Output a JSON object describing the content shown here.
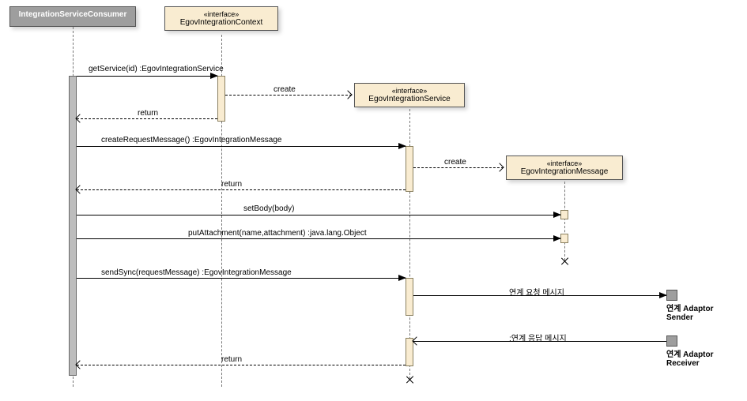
{
  "participants": {
    "consumer": {
      "name": "IntegrationServiceConsumer"
    },
    "context": {
      "stereotype": "«interface»",
      "name": "EgovIntegrationContext"
    },
    "service": {
      "stereotype": "«interface»",
      "name": "EgovIntegrationService"
    },
    "message": {
      "stereotype": "«interface»",
      "name": "EgovIntegrationMessage"
    }
  },
  "messages": {
    "getService": "getService(id) :EgovIntegrationService",
    "create1": "create",
    "return1": "return",
    "createRequest": "createRequestMessage() :EgovIntegrationMessage",
    "create2": "create",
    "return2": "return",
    "setBody": "setBody(body)",
    "putAttachment": "putAttachment(name,attachment) :java.lang.Object",
    "sendSync": "sendSync(requestMessage) :EgovIntegrationMessage",
    "requestMsg": "연계 요청 메시지",
    "replyMsg": ":연계 응답 메시지",
    "return3": "return"
  },
  "actors": {
    "sender": "연계 Adaptor Sender",
    "receiver": "연계 Adaptor Receiver"
  },
  "chart_data": {
    "type": "sequence-diagram",
    "participants": [
      "IntegrationServiceConsumer",
      "EgovIntegrationContext",
      "EgovIntegrationService",
      "EgovIntegrationMessage",
      "연계 Adaptor Sender",
      "연계 Adaptor Receiver"
    ],
    "interactions": [
      {
        "from": "IntegrationServiceConsumer",
        "to": "EgovIntegrationContext",
        "label": "getService(id) :EgovIntegrationService",
        "style": "call"
      },
      {
        "from": "EgovIntegrationContext",
        "to": "EgovIntegrationService",
        "label": "create",
        "style": "create"
      },
      {
        "from": "EgovIntegrationContext",
        "to": "IntegrationServiceConsumer",
        "label": "return",
        "style": "return"
      },
      {
        "from": "IntegrationServiceConsumer",
        "to": "EgovIntegrationService",
        "label": "createRequestMessage() :EgovIntegrationMessage",
        "style": "call"
      },
      {
        "from": "EgovIntegrationService",
        "to": "EgovIntegrationMessage",
        "label": "create",
        "style": "create"
      },
      {
        "from": "EgovIntegrationService",
        "to": "IntegrationServiceConsumer",
        "label": "return",
        "style": "return"
      },
      {
        "from": "IntegrationServiceConsumer",
        "to": "EgovIntegrationMessage",
        "label": "setBody(body)",
        "style": "call"
      },
      {
        "from": "IntegrationServiceConsumer",
        "to": "EgovIntegrationMessage",
        "label": "putAttachment(name,attachment) :java.lang.Object",
        "style": "call"
      },
      {
        "from": "IntegrationServiceConsumer",
        "to": "EgovIntegrationService",
        "label": "sendSync(requestMessage) :EgovIntegrationMessage",
        "style": "call"
      },
      {
        "from": "EgovIntegrationService",
        "to": "연계 Adaptor Sender",
        "label": "연계 요청 메시지",
        "style": "call"
      },
      {
        "from": "연계 Adaptor Receiver",
        "to": "EgovIntegrationService",
        "label": ":연계 응답 메시지",
        "style": "call"
      },
      {
        "from": "EgovIntegrationService",
        "to": "IntegrationServiceConsumer",
        "label": "return",
        "style": "return"
      }
    ],
    "destroy": [
      "EgovIntegrationMessage",
      "EgovIntegrationService"
    ]
  }
}
